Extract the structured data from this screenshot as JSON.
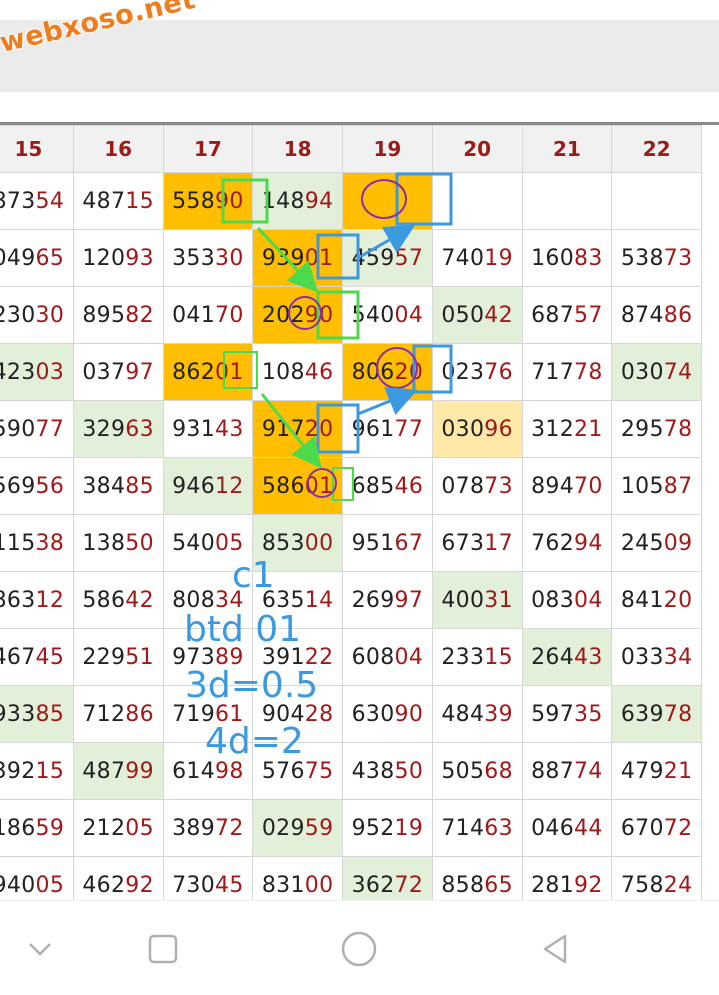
{
  "watermark": "webxoso.net",
  "columns": [
    "15",
    "16",
    "17",
    "18",
    "19",
    "20",
    "21",
    "22"
  ],
  "rows": [
    [
      "87354",
      "48715",
      "55890",
      "14894",
      "",
      "",
      "",
      ""
    ],
    [
      "04965",
      "12093",
      "35330",
      "93901",
      "45957",
      "74019",
      "16083",
      "53873"
    ],
    [
      "23030",
      "89582",
      "04170",
      "20290",
      "54004",
      "05042",
      "68757",
      "87486"
    ],
    [
      "42303",
      "03797",
      "86201",
      "10846",
      "80620",
      "02376",
      "71778",
      "03074"
    ],
    [
      "59077",
      "32963",
      "93143",
      "91720",
      "96177",
      "03096",
      "31221",
      "29578"
    ],
    [
      "56956",
      "38485",
      "94612",
      "58601",
      "68546",
      "07873",
      "89470",
      "10587"
    ],
    [
      "11538",
      "13850",
      "54005",
      "85300",
      "95167",
      "67317",
      "76294",
      "24509"
    ],
    [
      "86312",
      "58642",
      "80834",
      "63514",
      "26997",
      "40031",
      "08304",
      "84120"
    ],
    [
      "46745",
      "22951",
      "97389",
      "39122",
      "60804",
      "23315",
      "26443",
      "03334"
    ],
    [
      "93385",
      "71286",
      "71961",
      "90428",
      "63090",
      "48439",
      "59735",
      "63978"
    ],
    [
      "39215",
      "48799",
      "61498",
      "57675",
      "43850",
      "50568",
      "88774",
      "47921"
    ],
    [
      "18659",
      "21205",
      "38972",
      "02959",
      "95219",
      "71463",
      "04644",
      "67072"
    ],
    [
      "94005",
      "46292",
      "73045",
      "83100",
      "36272",
      "85865",
      "28192",
      "75824"
    ]
  ],
  "highlights": [
    [
      "",
      "",
      "orange",
      "green",
      "orange",
      "",
      "",
      ""
    ],
    [
      "",
      "",
      "",
      "orange",
      "green",
      "",
      "",
      ""
    ],
    [
      "",
      "",
      "",
      "orange",
      "",
      "green",
      "",
      ""
    ],
    [
      "green",
      "",
      "orange",
      "",
      "orange",
      "",
      "",
      "green"
    ],
    [
      "",
      "green",
      "",
      "orange",
      "",
      "lightorange",
      "",
      ""
    ],
    [
      "",
      "",
      "green",
      "orange",
      "",
      "",
      "",
      ""
    ],
    [
      "",
      "",
      "",
      "green",
      "",
      "",
      "",
      ""
    ],
    [
      "",
      "",
      "",
      "",
      "",
      "green",
      "",
      ""
    ],
    [
      "",
      "",
      "",
      "",
      "",
      "",
      "green",
      ""
    ],
    [
      "green",
      "",
      "",
      "",
      "",
      "",
      "",
      "green"
    ],
    [
      "",
      "green",
      "",
      "",
      "",
      "",
      "",
      ""
    ],
    [
      "",
      "",
      "",
      "green",
      "",
      "",
      "",
      ""
    ],
    [
      "",
      "",
      "",
      "",
      "green",
      "",
      "",
      ""
    ]
  ],
  "notes": {
    "line1": "c1",
    "line2": "btd 01",
    "line3": "3d=0.5",
    "line4": "4d=2"
  },
  "colors": {
    "orange": "#ffbe00",
    "green_cell": "#e2f0d9",
    "header_text": "#9b1b1b",
    "annotation_blue": "#3b99e0",
    "annotation_green": "#4cd94c",
    "annotation_purple": "#8a2fa8"
  },
  "nav": {
    "back_icon": "chevron-down-icon",
    "recents_icon": "square-icon",
    "home_icon": "circle-icon",
    "prev_icon": "triangle-left-icon"
  }
}
